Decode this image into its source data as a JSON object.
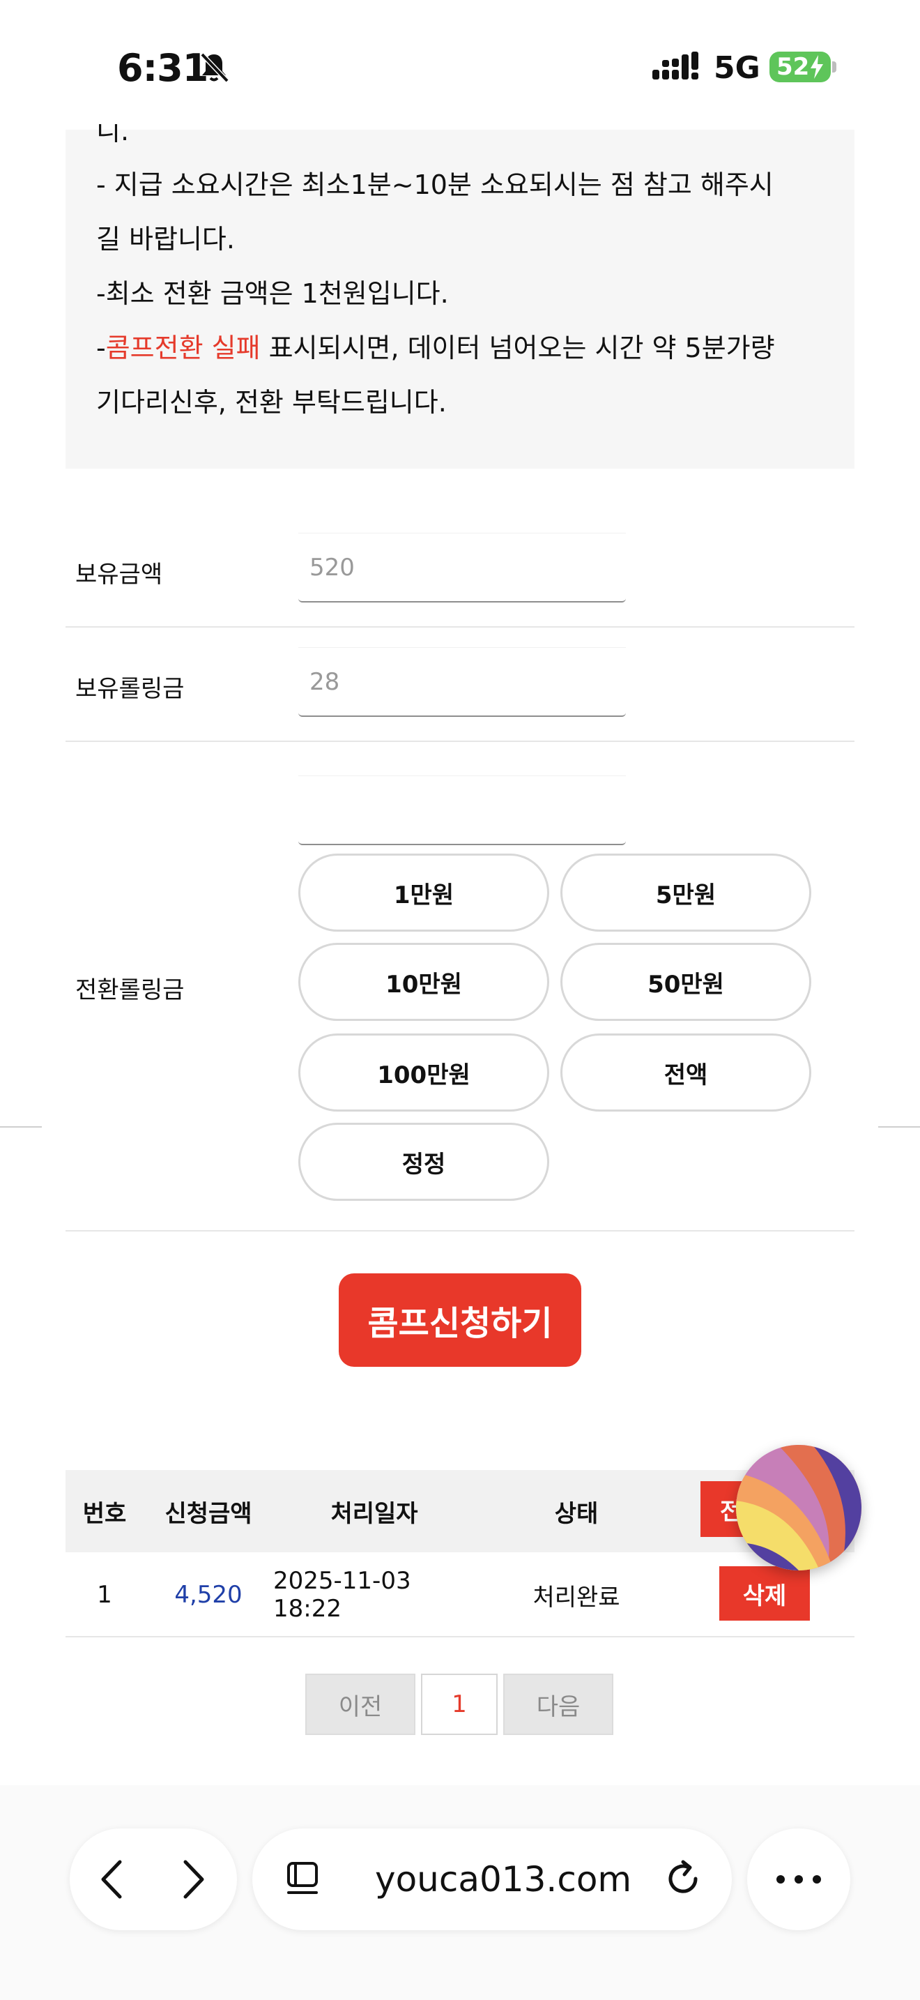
{
  "status_bar": {
    "time": "6:31",
    "network": "5G",
    "battery": "52"
  },
  "notice": {
    "cut_line": "니.",
    "line1": "- 지급 소요시간은 최소1분~10분 소요되시는 점 참고 해주시",
    "line2": "길 바랍니다.",
    "line3": "-최소 전환 금액은 1천원입니다.",
    "line4_prefix": "-",
    "line4_red": "콤프전환 실패",
    "line4_rest": " 표시되시면, 데이터 넘어오는 시간 약 5분가량",
    "line5": "기다리신후, 전환 부탁드립니다."
  },
  "form": {
    "balance_label": "보유금액",
    "balance_value": "520",
    "rolling_label": "보유롤링금",
    "rolling_value": "28",
    "convert_label": "전환롤링금",
    "convert_value": "",
    "amount_buttons": [
      "1만원",
      "5만원",
      "10만원",
      "50만원",
      "100만원",
      "전액",
      "정정"
    ],
    "submit_label": "콤프신청하기"
  },
  "table": {
    "headers": [
      "번호",
      "신청금액",
      "처리일자",
      "상태"
    ],
    "delete_all_label": "전",
    "rows": [
      {
        "no": "1",
        "amount": "4,520",
        "date": "2025-11-03 18:22",
        "status": "처리완료",
        "action": "삭제"
      }
    ]
  },
  "pagination": {
    "prev": "이전",
    "current": "1",
    "next": "다음"
  },
  "browser": {
    "url": "youca013.com"
  },
  "colors": {
    "accent_red": "#e8382a",
    "amount_blue": "#1f3fa8",
    "battery_green": "#5ec55a"
  }
}
